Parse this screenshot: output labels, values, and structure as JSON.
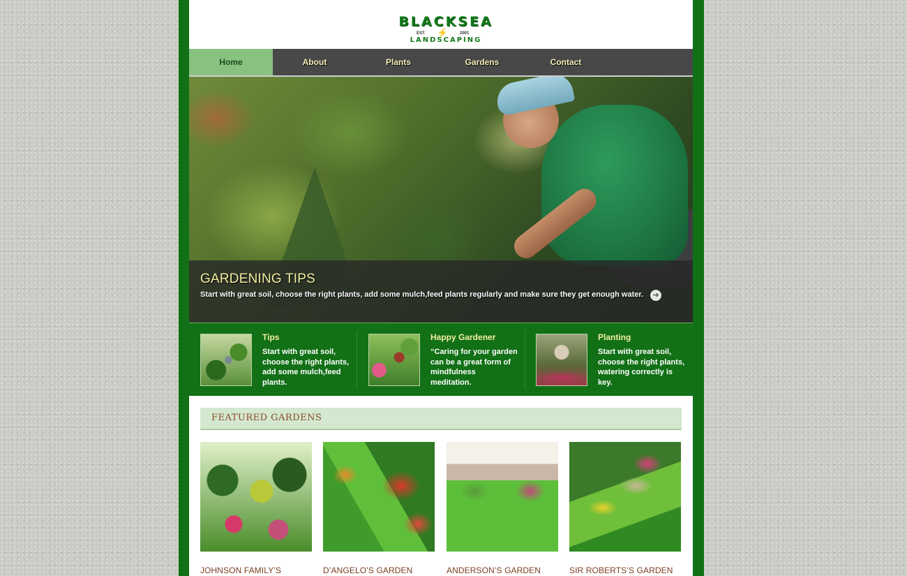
{
  "brand": {
    "name": "BLACKSEA",
    "sub": "LANDSCAPING",
    "est": "EST.",
    "year": "2001",
    "bolt_icon": "lightning-bolt-icon"
  },
  "nav": {
    "items": [
      {
        "label": "Home",
        "active": true
      },
      {
        "label": "About",
        "active": false
      },
      {
        "label": "Plants",
        "active": false
      },
      {
        "label": "Gardens",
        "active": false
      },
      {
        "label": "Contact",
        "active": false
      }
    ]
  },
  "hero": {
    "title": "GARDENING TIPS",
    "text": "Start with great soil, choose the right plants, add some mulch,feed plants regularly and make sure they get enough water.",
    "arrow_icon": "arrow-right-circle-icon",
    "arrow_glyph": "➜"
  },
  "features": [
    {
      "title": "Tips",
      "text": "Start with great soil, choose the right plants, add some mulch,feed plants."
    },
    {
      "title": "Happy Gardener",
      "text": "“Caring for your garden can be a great form of mindfulness meditation."
    },
    {
      "title": "Planting",
      "text": "Start with great soil, choose the right plants, watering correctly is key."
    }
  ],
  "featured": {
    "title": "FEATURED GARDENS",
    "gardens": [
      {
        "name": "JOHNSON FAMILY’S"
      },
      {
        "name": "D’ANGELO’S GARDEN"
      },
      {
        "name": "ANDERSON’S GARDEN"
      },
      {
        "name": "SIR ROBERTS’S GARDEN"
      }
    ]
  },
  "colors": {
    "frame_green": "#127016",
    "nav_gray": "#484848",
    "nav_active": "#88c281",
    "accent_yellow": "#f3eea3",
    "garden_name": "#7a3e22"
  }
}
